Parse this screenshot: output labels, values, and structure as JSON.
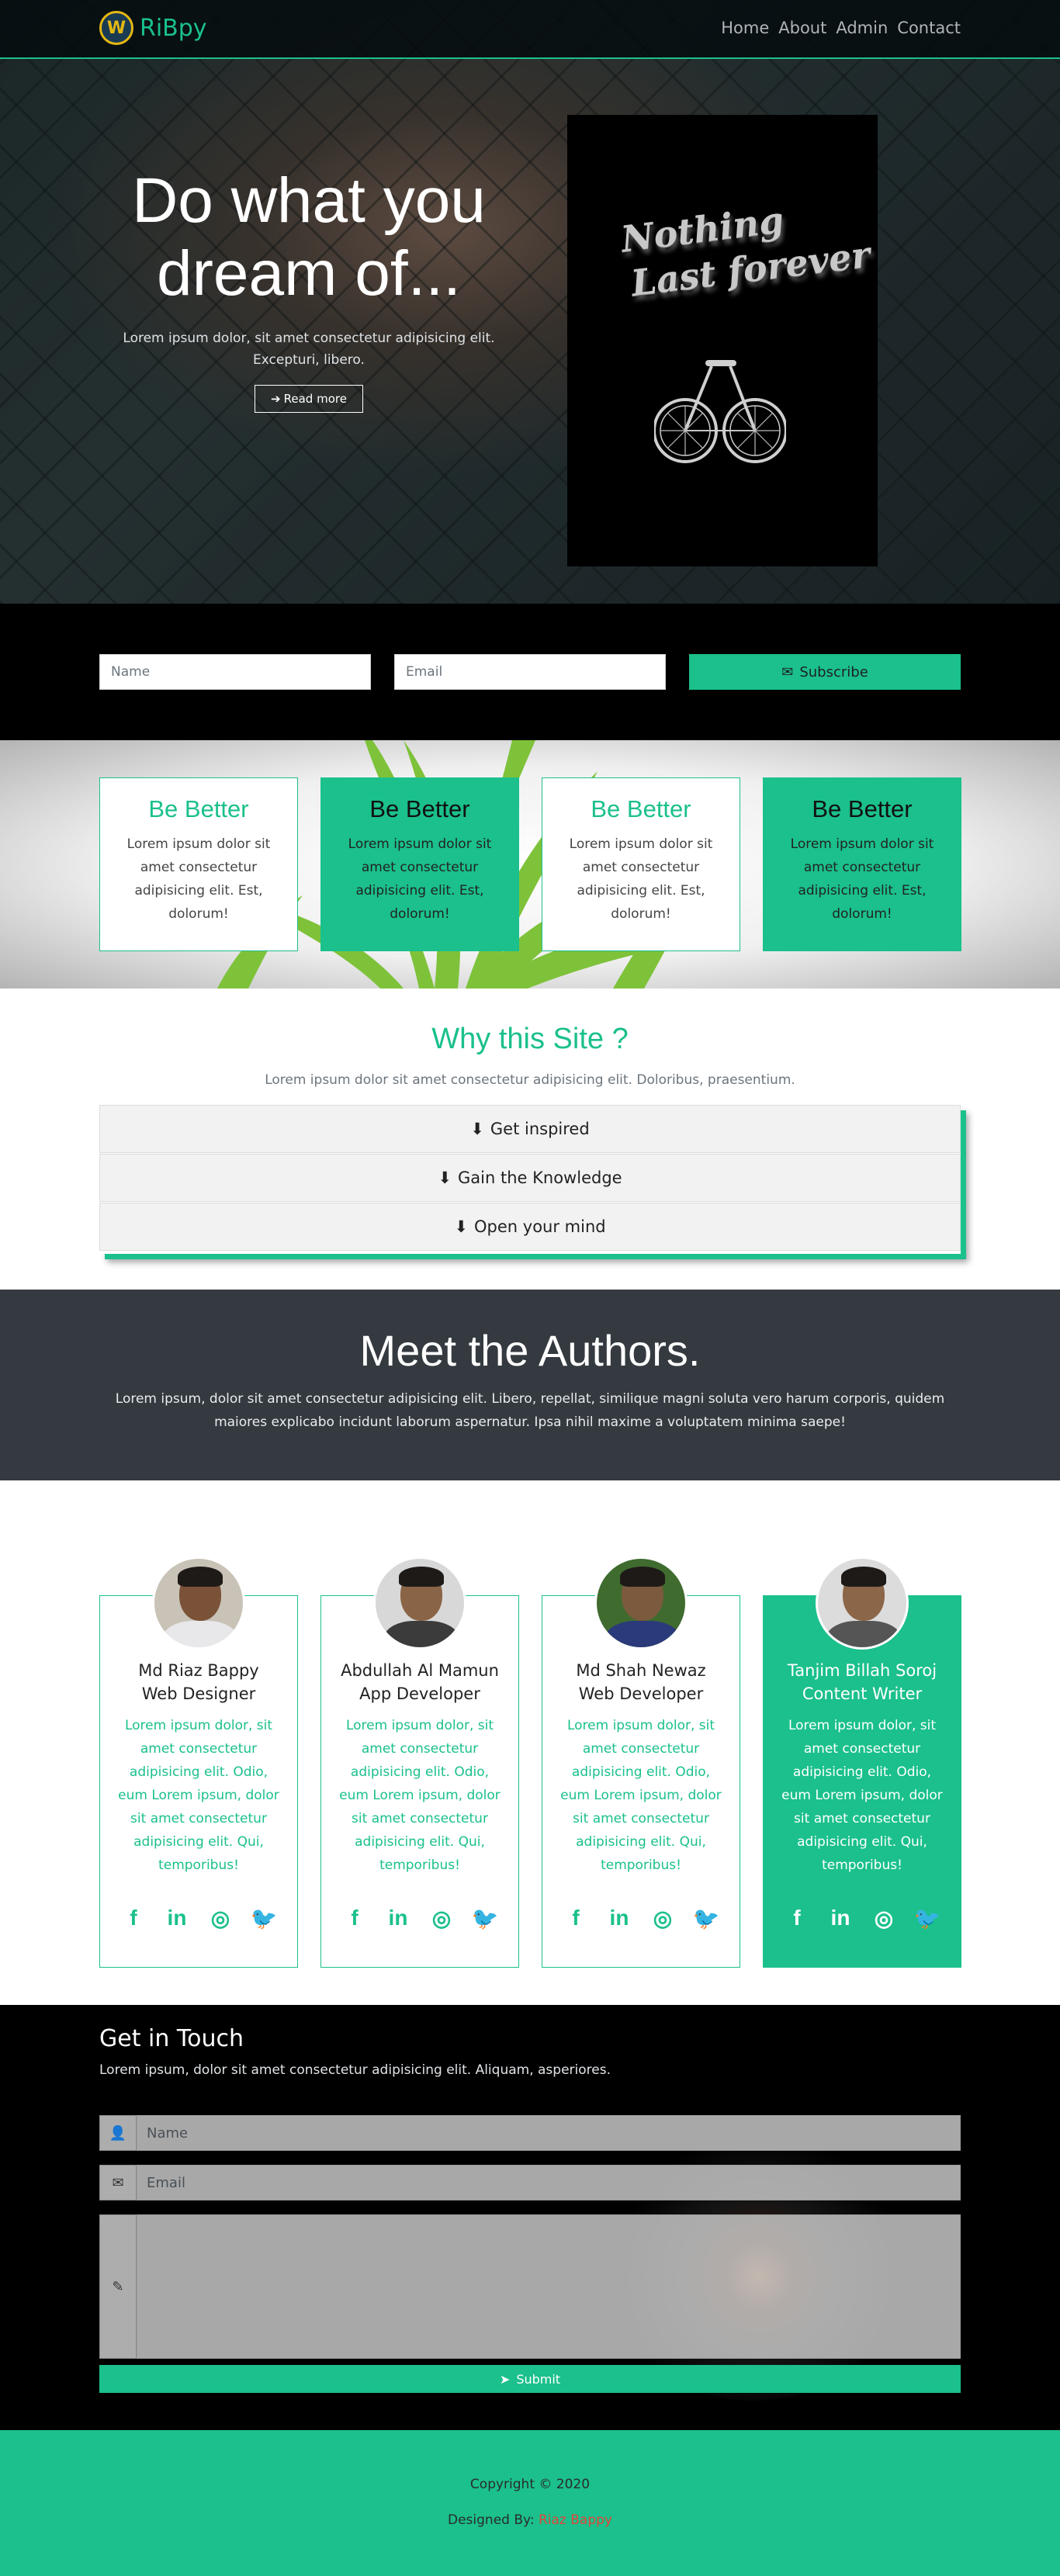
{
  "brand": {
    "name": "RiBpy",
    "logo_letter": "W",
    "accent": "#1bc08c"
  },
  "nav": {
    "items": [
      "Home",
      "About",
      "Admin",
      "Contact"
    ]
  },
  "hero": {
    "title": "Do what you dream of...",
    "text": "Lorem ipsum dolor, sit amet consectetur adipisicing elit. Excepturi, libero.",
    "button": "Read more",
    "poster_line1": "Nothing",
    "poster_line2": "Last forever"
  },
  "subscribe": {
    "name_placeholder": "Name",
    "email_placeholder": "Email",
    "button": "Subscribe"
  },
  "features": [
    {
      "title": "Be Better",
      "text": "Lorem ipsum dolor sit amet consectetur adipisicing elit. Est, dolorum!"
    },
    {
      "title": "Be Better",
      "text": "Lorem ipsum dolor sit amet consectetur adipisicing elit. Est, dolorum!"
    },
    {
      "title": "Be Better",
      "text": "Lorem ipsum dolor sit amet consectetur adipisicing elit. Est, dolorum!"
    },
    {
      "title": "Be Better",
      "text": "Lorem ipsum dolor sit amet consectetur adipisicing elit. Est, dolorum!"
    }
  ],
  "why": {
    "title": "Why this Site ?",
    "subtitle": "Lorem ipsum dolor sit amet consectetur adipisicing elit. Doloribus, praesentium.",
    "items": [
      "Get inspired",
      "Gain the Knowledge",
      "Open your mind"
    ]
  },
  "authors": {
    "title": "Meet the Authors.",
    "text": "Lorem ipsum, dolor sit amet consectetur adipisicing elit. Libero, repellat, similique magni soluta vero harum corporis, quidem maiores explicabo incidunt laborum aspernatur. Ipsa nihil maxime a voluptatem minima saepe!",
    "people": [
      {
        "name": "Md Riaz Bappy",
        "role": "Web Designer",
        "text": "Lorem ipsum dolor, sit amet consectetur adipisicing elit. Odio, eum Lorem ipsum, dolor sit amet consectetur adipisicing elit. Qui, temporibus!"
      },
      {
        "name": "Abdullah Al Mamun",
        "role": "App Developer",
        "text": "Lorem ipsum dolor, sit amet consectetur adipisicing elit. Odio, eum Lorem ipsum, dolor sit amet consectetur adipisicing elit. Qui, temporibus!"
      },
      {
        "name": "Md Shah Newaz",
        "role": "Web Developer",
        "text": "Lorem ipsum dolor, sit amet consectetur adipisicing elit. Odio, eum Lorem ipsum, dolor sit amet consectetur adipisicing elit. Qui, temporibus!"
      },
      {
        "name": "Tanjim Billah Soroj",
        "role": "Content Writer",
        "text": "Lorem ipsum dolor, sit amet consectetur adipisicing elit. Odio, eum Lorem ipsum, dolor sit amet consectetur adipisicing elit. Qui, temporibus!"
      }
    ],
    "social_icons": [
      "facebook-icon",
      "linkedin-icon",
      "instagram-icon",
      "twitter-icon"
    ]
  },
  "contact": {
    "title": "Get in Touch",
    "text": "Lorem ipsum, dolor sit amet consectetur adipisicing elit. Aliquam, asperiores.",
    "name_placeholder": "Name",
    "email_placeholder": "Email",
    "submit": "Submit"
  },
  "footer": {
    "copyright": "Copyright © 2020",
    "designed_by": "Designed By:",
    "author": "Riaz Bappy"
  }
}
